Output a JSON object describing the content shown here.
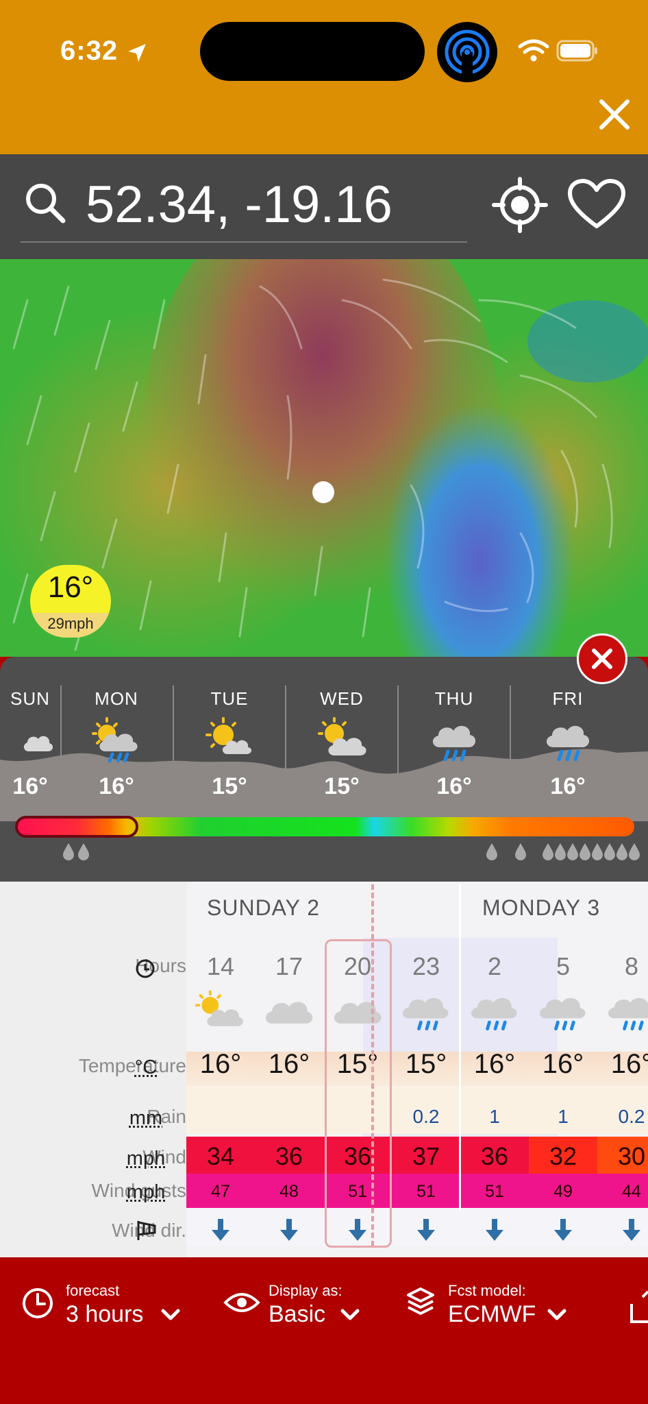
{
  "status": {
    "time": "6:32"
  },
  "search": {
    "query": "52.34, -19.16"
  },
  "map_badge": {
    "temp": "16°",
    "wind": "29mph"
  },
  "daily": [
    {
      "day": "SUN",
      "temp": "16°",
      "icon": "cloud-icon"
    },
    {
      "day": "MON",
      "temp": "16°",
      "icon": "sun-rain-cloud-icon"
    },
    {
      "day": "TUE",
      "temp": "15°",
      "icon": "sun-cloud-icon"
    },
    {
      "day": "WED",
      "temp": "15°",
      "icon": "sun-cloud-icon"
    },
    {
      "day": "THU",
      "temp": "16°",
      "icon": "rain-cloud-icon"
    },
    {
      "day": "FRI",
      "temp": "16°",
      "icon": "rain-cloud-icon"
    }
  ],
  "table": {
    "days": [
      "SUNDAY 2",
      "MONDAY 3"
    ],
    "labels": {
      "hours": "Hours",
      "temperature": "Temperature",
      "rain": "Rain",
      "wind": "Wind",
      "gusts": "Wind gusts",
      "dir": "Wind dir."
    },
    "units": {
      "temperature": "°C",
      "rain": "mm",
      "wind": "mph",
      "gusts": "mph"
    },
    "hours": [
      "14",
      "17",
      "20",
      "23",
      "2",
      "5",
      "8"
    ],
    "temps": [
      "16°",
      "16°",
      "15°",
      "15°",
      "16°",
      "16°",
      "16°"
    ],
    "rain": [
      "",
      "",
      "",
      "0.2",
      "1",
      "1",
      "0.2"
    ],
    "wind": [
      "34",
      "36",
      "36",
      "37",
      "36",
      "32",
      "30"
    ],
    "gusts": [
      "47",
      "48",
      "51",
      "51",
      "51",
      "49",
      "44"
    ],
    "wind_colors": [
      "#f0113f",
      "#f0113f",
      "#f0113f",
      "#f0113f",
      "#f0113f",
      "#ff2a1c",
      "#ff4a10"
    ],
    "gust_colors": [
      "#f0148c",
      "#f0148c",
      "#f0148c",
      "#f0148c",
      "#f0148c",
      "#f0148c",
      "#f0148c"
    ]
  },
  "bottom": {
    "forecast_label": "forecast",
    "forecast_value": "3 hours",
    "display_label": "Display as:",
    "display_value": "Basic",
    "model_label": "Fcst model:",
    "model_value": "ECMWF"
  },
  "colors": {
    "header": "#dc8f02",
    "bottom": "#b00000",
    "search": "#474747"
  }
}
